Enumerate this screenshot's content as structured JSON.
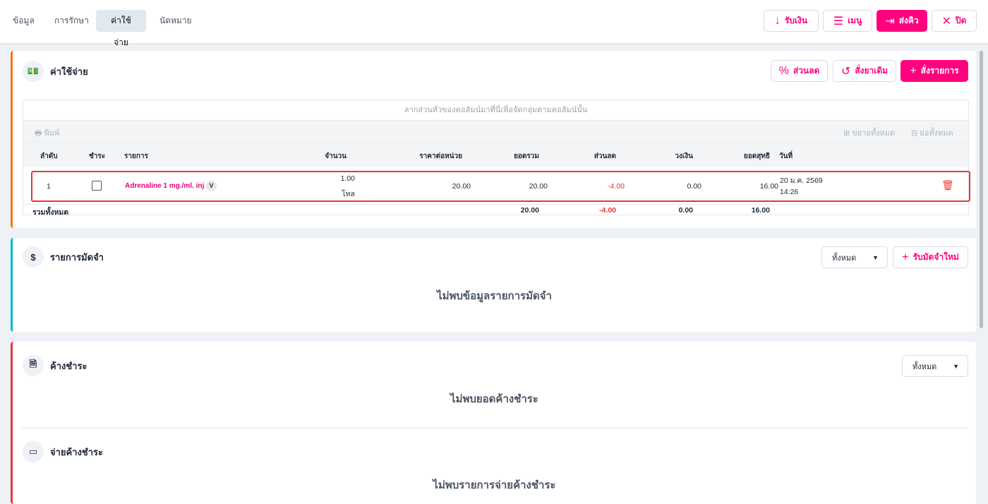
{
  "tabs": [
    {
      "label": "ข้อมูล"
    },
    {
      "label": "การรักษา"
    },
    {
      "label": "ค่าใช้จ่าย",
      "active": true
    },
    {
      "label": "นัดหมาย"
    }
  ],
  "header_buttons": {
    "receive": "รับเงิน",
    "menu": "เมนู",
    "send_queue": "ส่งคิว",
    "close": "ปิด"
  },
  "expenses": {
    "title": "ค่าใช้จ่าย",
    "discount": "ส่วนลด",
    "reorder": "สั่งยาเดิม",
    "order": "สั่งรายการ",
    "group_hint": "ลากส่วนหัวของคอลัมน์มาที่นี่เพื่อจัดกลุ่มตามคอลัมน์นั้น",
    "print": "พิมพ์",
    "expand_all": "ขยายทั้งหมด",
    "collapse_all": "ย่อทั้งหมด",
    "columns": [
      "ลำดับ",
      "ชำระ",
      "รายการ",
      "จำนวน",
      "ราคาต่อหน่วย",
      "ยอดรวม",
      "ส่วนลด",
      "วงเงิน",
      "ยอดสุทธิ",
      "วันที่"
    ],
    "rows": [
      {
        "no": "1",
        "paid": false,
        "item": "Adrenaline 1 mg./ml. inj",
        "badge": "V",
        "qty": "1.00",
        "unit": "โหล",
        "price": "20.00",
        "total": "20.00",
        "discount": "-4.00",
        "credit": "0.00",
        "net": "16.00",
        "date": "20 ม.ค. 2569",
        "time": "14:26"
      }
    ],
    "footer": {
      "label": "รวมทั้งหมด",
      "total": "20.00",
      "discount": "-4.00",
      "credit": "0.00",
      "net": "16.00"
    }
  },
  "deposits": {
    "title": "รายการมัดจำ",
    "filter": "ทั้งหมด",
    "new": "รับมัดจำใหม่",
    "empty": "ไม่พบข้อมูลรายการมัดจำ"
  },
  "outstanding": {
    "title": "ค้างชำระ",
    "filter": "ทั้งหมด",
    "empty": "ไม่พบยอดค้างชำระ"
  },
  "pay_outstanding": {
    "title": "จ่ายค้างชำระ",
    "empty": "ไม่พบรายการจ่ายค้างชำระ"
  },
  "colors": {
    "accent": "#ff007f",
    "expenses_border": "#f97316",
    "deposits_border": "#06b6d4",
    "outstanding_border": "#e53935",
    "negative": "#e53935"
  }
}
